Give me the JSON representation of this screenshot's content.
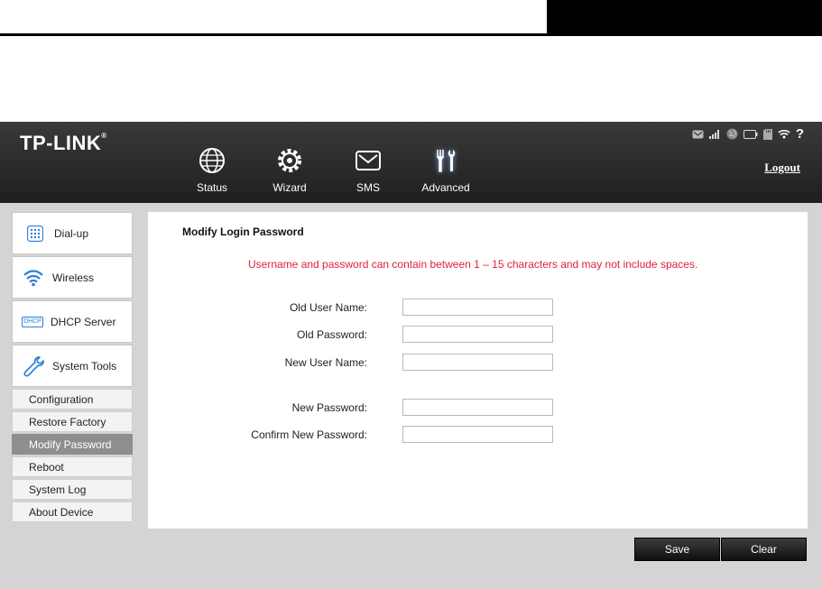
{
  "brand": {
    "logo": "TP-LINK",
    "logo_mark": "®"
  },
  "nav": [
    {
      "label": "Status",
      "icon": "globe-icon"
    },
    {
      "label": "Wizard",
      "icon": "gear-icon"
    },
    {
      "label": "SMS",
      "icon": "envelope-icon"
    },
    {
      "label": "Advanced",
      "icon": "tools-icon",
      "active": true
    }
  ],
  "status_icons": [
    "message-icon",
    "signal-icon",
    "internet-globe-icon",
    "battery-icon",
    "sd-card-icon",
    "wifi-icon",
    "help-icon"
  ],
  "logout_label": "Logout",
  "sidebar": {
    "main": [
      {
        "label": "Dial-up",
        "icon": "dialpad-icon"
      },
      {
        "label": "Wireless",
        "icon": "wifi-icon"
      },
      {
        "label": "DHCP Server",
        "icon": "dhcp-icon",
        "icon_text": "DHCP"
      },
      {
        "label": "System Tools",
        "icon": "wrench-icon"
      }
    ],
    "sub": [
      {
        "label": "Configuration"
      },
      {
        "label": "Restore Factory"
      },
      {
        "label": "Modify Password",
        "active": true
      },
      {
        "label": "Reboot"
      },
      {
        "label": "System Log"
      },
      {
        "label": "About Device"
      }
    ]
  },
  "panel": {
    "title": "Modify Login Password",
    "notice": "Username and password can contain between 1 – 15 characters and may not include spaces.",
    "fields": [
      {
        "label": "Old User Name:",
        "value": ""
      },
      {
        "label": "Old Password:",
        "value": ""
      },
      {
        "label": "New User Name:",
        "value": ""
      },
      {
        "label": "New Password:",
        "value": ""
      },
      {
        "label": "Confirm New Password:",
        "value": ""
      }
    ]
  },
  "buttons": {
    "save": "Save",
    "clear": "Clear"
  },
  "colors": {
    "notice": "#e0203a",
    "active_sub": "#8e8e8e",
    "topbar": "#2a2a2a"
  }
}
